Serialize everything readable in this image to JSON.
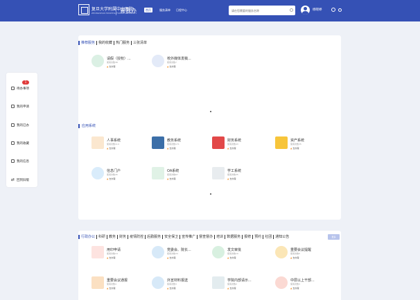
{
  "header": {
    "logo_text": "复旦大学附属中山医院",
    "logo_sub": "ZHONGSHAN HOSPITAL FUDAN UNIVERSITY",
    "app_name": "青我办",
    "nav": [
      "首页",
      "服务清单",
      "日程中心"
    ],
    "search_placeholder": "请在您需要的服务名称",
    "username": "杨晓婷"
  },
  "sidebar": {
    "badge": "1",
    "items": [
      "待办事项",
      "我的申请",
      "我的已办",
      "我的收藏",
      "我的信息",
      "回到旧版"
    ]
  },
  "panel1": {
    "tabs": [
      "推荐服务",
      "我的收藏",
      "热门服务",
      "三张清单"
    ],
    "recommended": [
      {
        "title": "请假（授权）...",
        "meta": "使用次数38",
        "hot": "去办理"
      },
      {
        "title": "校外媒体发稿...",
        "meta": "使用次数7",
        "hot": "去办理"
      }
    ],
    "app_section_title": "应用系统",
    "apps": [
      {
        "title": "人事系统",
        "meta": "使用次数114",
        "hot": "去办理"
      },
      {
        "title": "教务系统",
        "meta": "使用次数171",
        "hot": "去办理"
      },
      {
        "title": "财务系统",
        "meta": "使用次数43",
        "hot": "去办理"
      },
      {
        "title": "资产系统",
        "meta": "使用次数35",
        "hot": "去办理"
      },
      {
        "title": "信息门户",
        "meta": "使用次数45",
        "hot": "去办理"
      },
      {
        "title": "OA系统",
        "meta": "使用次数67",
        "hot": "去办理"
      },
      {
        "title": "学工系统",
        "meta": "使用次数35",
        "hot": "去办理"
      }
    ]
  },
  "panel2": {
    "tabs": [
      "行政办公",
      "科研",
      "教务",
      "财务",
      "疫情防控",
      "后勤服务",
      "安全保卫",
      "宣传推广",
      "督查督办",
      "培训",
      "数据服务",
      "报修",
      "预约",
      "社团",
      "通知公告"
    ],
    "more": "更多",
    "items": [
      {
        "title": "用印申请",
        "meta": "使用次数14",
        "hot": "去办理"
      },
      {
        "title": "党委会、院长...",
        "meta": "使用次数34",
        "hot": "去办理"
      },
      {
        "title": "发文审批",
        "meta": "使用次数19",
        "hot": "去办理"
      },
      {
        "title": "重要会议提醒",
        "meta": "使用次数5",
        "hot": "去办理"
      },
      {
        "title": "重要会议通报",
        "meta": "使用次数4",
        "hot": "去办理"
      },
      {
        "title": "外宣材料报送",
        "meta": "使用次数3",
        "hot": "去办理"
      },
      {
        "title": "学院内部请示...",
        "meta": "使用次数2",
        "hot": "去办理"
      },
      {
        "title": "中层以上干部...",
        "meta": "使用次数3",
        "hot": "去办理"
      }
    ]
  },
  "colors": {
    "primary": "#3551b5",
    "badge": "#e03a3a",
    "hot": "#f08c20",
    "bg": "#eef1f7"
  }
}
